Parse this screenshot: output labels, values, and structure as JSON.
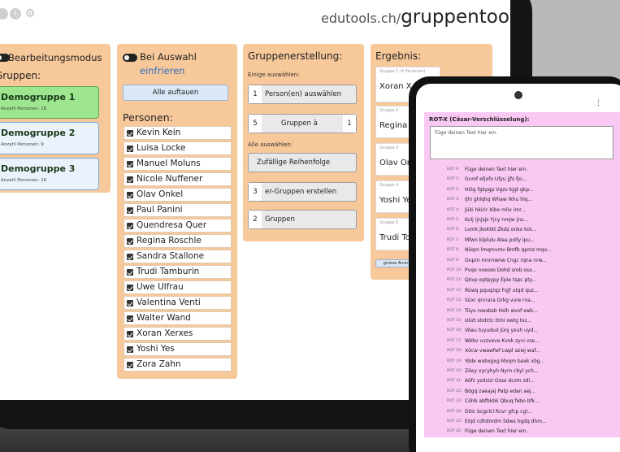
{
  "brand": {
    "domain": "edutools.ch/",
    "tool": "gruppentoo"
  },
  "topbar": {
    "info_symbol": "i",
    "settings_symbol": "⚙"
  },
  "groups_panel": {
    "edit_mode_label": "Bearbeitungsmodus",
    "title": "Gruppen:",
    "groups": [
      {
        "name": "Demogruppe 1",
        "sub": "Anzahl Personen: 16",
        "active": true
      },
      {
        "name": "Demogruppe 2",
        "sub": "Anzahl Personen: 9",
        "active": false
      },
      {
        "name": "Demogruppe 3",
        "sub": "Anzahl Personen: 16",
        "active": false
      }
    ]
  },
  "persons_panel": {
    "selection_label": "Bei Auswahl",
    "selection_action": "einfrieren",
    "show_all_button": "Alle auftauen",
    "title": "Personen:",
    "persons": [
      "Kevin Kein",
      "Luisa Locke",
      "Manuel Moluns",
      "Nicole Nuffener",
      "Olav Onkel",
      "Paul Panini",
      "Quendresa Quer",
      "Regina Roschle",
      "Sandra Stallone",
      "Trudi Tamburin",
      "Uwe Ulfrau",
      "Valentina Venti",
      "Walter Wand",
      "Xoran Xerxes",
      "Yoshi Yes",
      "Zora Zahn"
    ]
  },
  "create_panel": {
    "title": "Gruppenerstellung:",
    "some_label": "Einige auswählen:",
    "select_persons": {
      "num": "1",
      "label": "Person(en) auswählen"
    },
    "groups_of": {
      "num": "5",
      "label": "Gruppen à",
      "num2": "1"
    },
    "all_label": "Alle auswählen:",
    "random_order": "Zufällige Reihenfolge",
    "create_groups": {
      "num": "3",
      "label": "er-Gruppen erstellen"
    },
    "groups": {
      "num": "2",
      "label": "Gruppen"
    }
  },
  "result_panel": {
    "title": "Ergebnis:",
    "boxes": [
      {
        "label": "Gruppe 1 (4 Personen)",
        "name": "Xoran X"
      },
      {
        "label": "Gruppe 2",
        "name": "Regina"
      },
      {
        "label": "Gruppe 3",
        "name": "Olav Or"
      },
      {
        "label": "Gruppe 4",
        "name": "Yoshi Ye"
      },
      {
        "label": "Gruppe 5",
        "name": "Trudi To"
      }
    ],
    "export_button": "grosse Ansicht"
  },
  "phone": {
    "menu": "⋮",
    "title": "ROT-X (Cäsar-Verschlüsselung):",
    "input_placeholder": "Füge deinen Text hier ein.",
    "lines": [
      {
        "key": "ROT 0:",
        "val": "Füge deinen Text hier ein."
      },
      {
        "key": "ROT 1:",
        "val": "Gvmf efjofo Ufyu jjfs fjo..."
      },
      {
        "key": "ROT 2:",
        "val": "Hiög fgkpgp Vgzv kjgt gkp..."
      },
      {
        "key": "ROT 3:",
        "val": "Ijhi ghlqhq Whaw lkhu hlq..."
      },
      {
        "key": "ROT 4:",
        "val": "Jüki hkirir Xibx mliv imr..."
      },
      {
        "key": "ROT 5:",
        "val": "Kulj ijnjsjs Yjcy nmjw jns..."
      },
      {
        "key": "ROT 6:",
        "val": "Lvmk jkoktkt Zkdz onkx kot..."
      },
      {
        "key": "ROT 7:",
        "val": "Mfwn klplulu Alea polly lpu..."
      },
      {
        "key": "ROT 8:",
        "val": "Nöqm lmqmvmv Bmfb qpmz mqv..."
      },
      {
        "key": "ROT 9:",
        "val": "Ouprn mnrnwnw Cngc rqna nrw..."
      },
      {
        "key": "ROT 10:",
        "val": "Pvqo noxoxo Dohd srob osx..."
      },
      {
        "key": "ROT 11:",
        "val": "Qövp optpypy Epie tspc pty..."
      },
      {
        "key": "ROT 12:",
        "val": "Rüwq pquqzqz Fqjf utqd quz..."
      },
      {
        "key": "ROT 13:",
        "val": "Süxr qrvrara Grkg vure rva..."
      },
      {
        "key": "ROT 14:",
        "val": "Tüys rswsbsb Hslh wvsf swb..."
      },
      {
        "key": "ROT 15:",
        "val": "Uözt stxtctc Itmi xwtg txc..."
      },
      {
        "key": "ROT 16:",
        "val": "Vöau tuyudud Jünj yxuh uyd..."
      },
      {
        "key": "ROT 17:",
        "val": "Wöbv uvzveve Kvok zyvi vze..."
      },
      {
        "key": "ROT 18:",
        "val": "Xöcw vwawfwf Lwpl azwj waf..."
      },
      {
        "key": "ROT 19:",
        "val": "Yödx wxbxgxg Mxqm baxk xbg..."
      },
      {
        "key": "ROT 20:",
        "val": "Zöey xycyhyh Nyrn cbyl ych..."
      },
      {
        "key": "ROT 21:",
        "val": "Aöfz yzdzizi Ozso dczm zdi..."
      },
      {
        "key": "ROT 22:",
        "val": "Bögq zaeajaj Patp edan aej..."
      },
      {
        "key": "ROT 23:",
        "val": "Cöhb abfbkbk Qbuq febo bfk..."
      },
      {
        "key": "ROT 24:",
        "val": "Döic bcgclcl Rcvr gfcp cgl..."
      },
      {
        "key": "ROT 25:",
        "val": "Eöjd cdhdmdm Sdws hgdq dhm..."
      },
      {
        "key": "ROT 26:",
        "val": "Füge deinen Text hier ein."
      }
    ]
  },
  "colors": {
    "panel": "#f7c89a",
    "active_group": "#9de58f",
    "group": "#eaf2fb",
    "phone_panel": "#f9c8f3",
    "link": "#2f6fbf"
  }
}
